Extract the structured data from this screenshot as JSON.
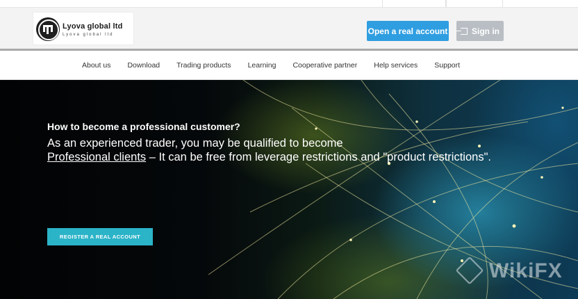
{
  "brand": {
    "name": "Lyova global ltd",
    "tagline": "Lyova global ltd"
  },
  "header": {
    "open_account_label": "Open a real account",
    "sign_in_label": "Sign in"
  },
  "nav": {
    "items": [
      {
        "label": "About us"
      },
      {
        "label": "Download"
      },
      {
        "label": "Trading products"
      },
      {
        "label": "Learning"
      },
      {
        "label": "Cooperative partner"
      },
      {
        "label": "Help services"
      },
      {
        "label": "Support"
      }
    ]
  },
  "hero": {
    "title": "How to become a professional customer?",
    "line1": "As an experienced trader, you may be qualified to become",
    "line2_link": "Professional clients",
    "line2_rest": " – It can be free from leverage restrictions and \"product restrictions\".",
    "register_label": "REGISTER A REAL ACCOUNT"
  },
  "watermark": {
    "text": "WikiFX"
  },
  "icons": {
    "logo": "lyova-logo-icon",
    "sign_in": "sign-in-icon",
    "watermark": "wikifx-logo-icon"
  },
  "colors": {
    "primary_button": "#2f9ee1",
    "secondary_button": "#b9bec4",
    "register_button": "#2bb3c8",
    "header_background": "#f3f3f3"
  }
}
